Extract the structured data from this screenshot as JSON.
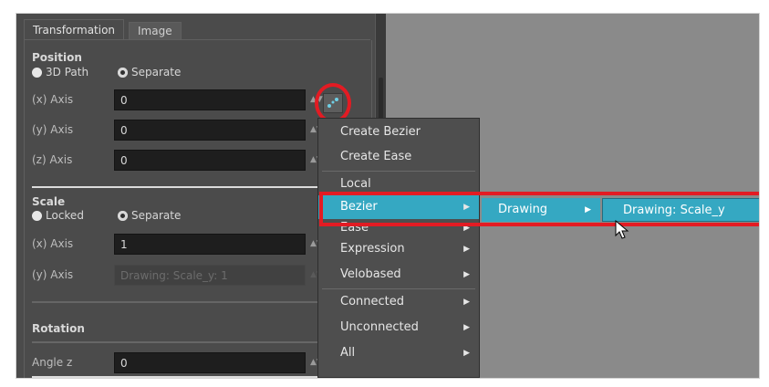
{
  "tabs": {
    "active": "Transformation",
    "inactive": "Image"
  },
  "position": {
    "title": "Position",
    "radio_3d": "3D Path",
    "radio_separate": "Separate",
    "x_label": "(x) Axis",
    "x_value": "0",
    "y_label": "(y) Axis",
    "y_value": "0",
    "z_label": "(z) Axis",
    "z_value": "0"
  },
  "scale": {
    "title": "Scale",
    "radio_locked": "Locked",
    "radio_separate": "Separate",
    "x_label": "(x) Axis",
    "x_value": "1",
    "y_label": "(y) Axis",
    "y_value": "Drawing: Scale_y: 1"
  },
  "rotation": {
    "title": "Rotation",
    "angle_label": "Angle z",
    "angle_value": "0"
  },
  "context_menu": {
    "items": [
      "Create Bezier",
      "Create Ease",
      "Local",
      "Bezier",
      "Ease",
      "Expression",
      "Velobased",
      "Connected",
      "Unconnected",
      "All"
    ]
  },
  "submenu_1": {
    "label": "Drawing"
  },
  "submenu_2": {
    "label": "Drawing: Scale_y"
  },
  "icons": {
    "function_button": "function-curve-icon",
    "spinner": "spin-arrows-icon",
    "cursor": "mouse-pointer-icon"
  },
  "colors": {
    "panel_bg": "#4b4b4b",
    "menu_highlight": "#35a8c2",
    "annotation_red": "#e31b23",
    "viewport_bg": "#8a8a8a"
  }
}
